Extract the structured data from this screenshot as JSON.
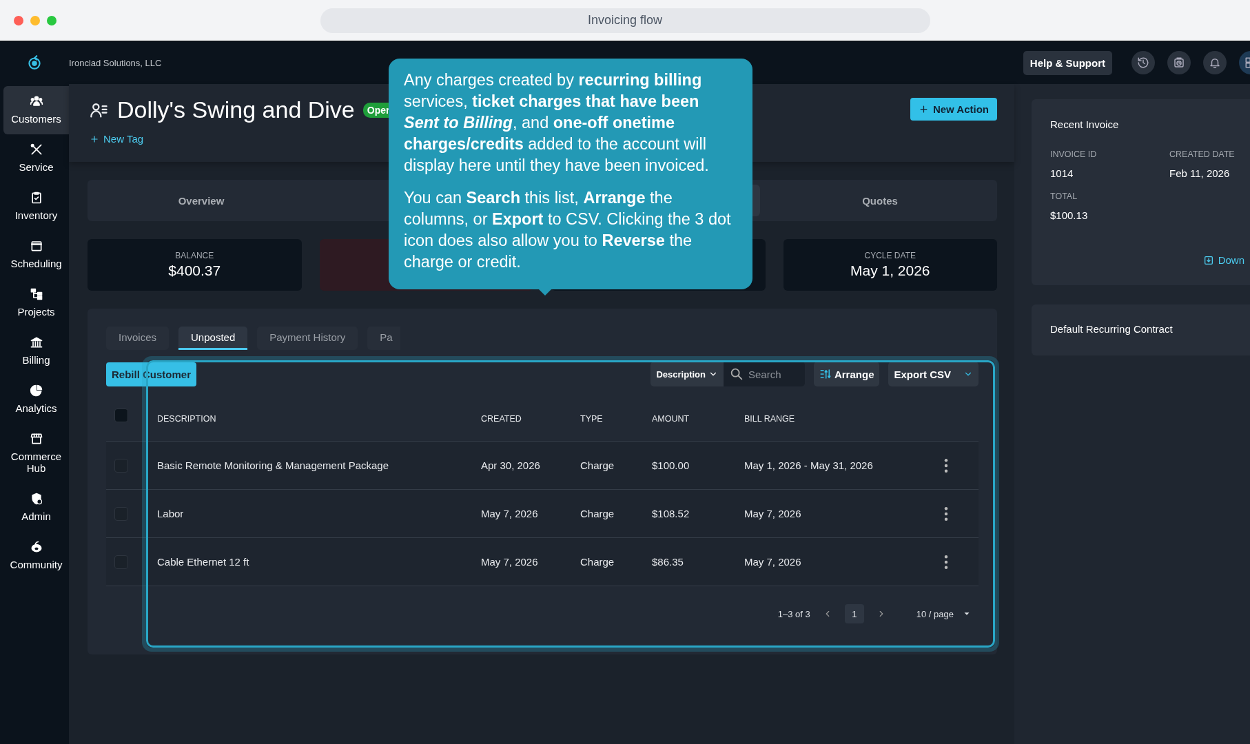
{
  "window": {
    "title": "Invoicing flow"
  },
  "topbar": {
    "company": "Ironclad Solutions, LLC",
    "help_button": "Help & Support"
  },
  "sidebar": {
    "items": [
      {
        "label": "Customers",
        "selected": true
      },
      {
        "label": "Service",
        "selected": false
      },
      {
        "label": "Inventory",
        "selected": false
      },
      {
        "label": "Scheduling",
        "selected": false
      },
      {
        "label": "Projects",
        "selected": false
      },
      {
        "label": "Billing",
        "selected": false
      },
      {
        "label": "Analytics",
        "selected": false
      },
      {
        "label": "Commerce Hub",
        "selected": false
      },
      {
        "label": "Admin",
        "selected": false
      },
      {
        "label": "Community",
        "selected": false
      }
    ]
  },
  "customer": {
    "name": "Dolly's Swing and Dive",
    "status": "Oper",
    "new_tag": "New Tag",
    "new_action": "New Action"
  },
  "section_tabs": [
    {
      "label": "Overview",
      "selected": false
    },
    {
      "label": "Quotes",
      "selected": false
    }
  ],
  "stats": [
    {
      "kind": "figure",
      "label": "BALANCE",
      "value": "$400.37"
    },
    {
      "kind": "alert"
    },
    {
      "kind": "blank"
    },
    {
      "kind": "figure",
      "label": "CYCLE DATE",
      "value": "May 1, 2026"
    }
  ],
  "sub_tabs": [
    {
      "label": "Invoices",
      "selected": false
    },
    {
      "label": "Unposted",
      "selected": true
    },
    {
      "label": "Payment History",
      "selected": false
    },
    {
      "label": "Pa",
      "selected": false
    }
  ],
  "toolbar": {
    "rebill_button": "Rebill Customer",
    "filter": "Description",
    "search": {
      "placeholder": "Search"
    },
    "arrange_button": "Arrange",
    "export_button": "Export CSV"
  },
  "table": {
    "header_checked": false,
    "columns": [
      "DESCRIPTION",
      "CREATED",
      "TYPE",
      "AMOUNT",
      "BILL RANGE"
    ],
    "rows": [
      {
        "checked": false,
        "cells": [
          "Basic Remote Monitoring & Management Package",
          "Apr 30, 2026",
          "Charge",
          "$100.00",
          "May 1, 2026 - May 31, 2026"
        ]
      },
      {
        "checked": false,
        "cells": [
          "Labor",
          "May 7, 2026",
          "Charge",
          "$108.52",
          "May 7, 2026"
        ]
      },
      {
        "checked": false,
        "cells": [
          "Cable Ethernet 12 ft",
          "May 7, 2026",
          "Charge",
          "$86.35",
          "May 7, 2026"
        ]
      }
    ]
  },
  "pagination": {
    "range": "1–3 of 3",
    "pages": [
      {
        "label": "1",
        "selected": true
      }
    ],
    "page_size": "10 / page"
  },
  "tooltip": {
    "paragraphs": [
      "Any charges created by **recurring billing** services, **ticket charges that have been** *Sent to Billing*, and **one-off onetime charges/credits** added to the account will display here until they have been invoiced.",
      "You can **Search** this list, **Arrange** the columns, or **Export** to CSV. Clicking the 3 dot icon does also allow you to **Reverse** the charge or credit."
    ]
  },
  "right_panel": {
    "recent_invoice": {
      "title": "Recent Invoice",
      "fields": [
        {
          "label": "INVOICE ID",
          "value": "1014"
        },
        {
          "label": "CREATED DATE",
          "value": "Feb 11, 2026"
        },
        {
          "label": "TOTAL",
          "value": "$100.13"
        }
      ],
      "download": "Down"
    },
    "contract": {
      "title": "Default Recurring Contract"
    }
  }
}
